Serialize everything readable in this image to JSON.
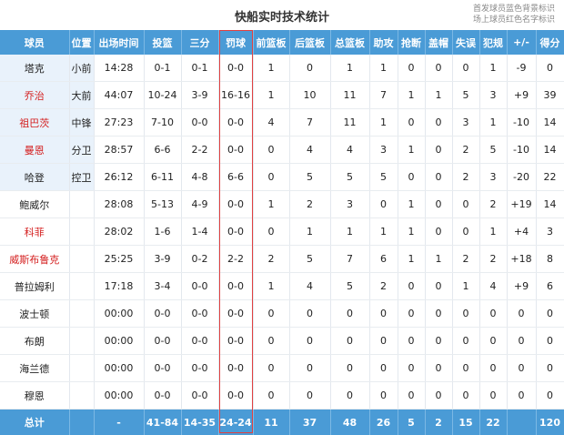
{
  "title": "快船实时技术统计",
  "legend": [
    "首发球员蓝色背景标识",
    "场上球员红色名字标识"
  ],
  "headers": [
    "球员",
    "位置",
    "出场时间",
    "投篮",
    "三分",
    "罚球",
    "前篮板",
    "后篮板",
    "总篮板",
    "助攻",
    "抢断",
    "盖帽",
    "失误",
    "犯规",
    "+/-",
    "得分"
  ],
  "rows": [
    {
      "name": "塔克",
      "starter": true,
      "on_court": false,
      "cells": [
        "小前",
        "14:28",
        "0-1",
        "0-1",
        "0-0",
        "1",
        "0",
        "1",
        "1",
        "0",
        "0",
        "0",
        "1",
        "-9",
        "0"
      ]
    },
    {
      "name": "乔治",
      "starter": true,
      "on_court": true,
      "cells": [
        "大前",
        "44:07",
        "10-24",
        "3-9",
        "16-16",
        "1",
        "10",
        "11",
        "7",
        "1",
        "1",
        "5",
        "3",
        "+9",
        "39"
      ]
    },
    {
      "name": "祖巴茨",
      "starter": true,
      "on_court": true,
      "cells": [
        "中锋",
        "27:23",
        "7-10",
        "0-0",
        "0-0",
        "4",
        "7",
        "11",
        "1",
        "0",
        "0",
        "3",
        "1",
        "-10",
        "14"
      ]
    },
    {
      "name": "曼恩",
      "starter": true,
      "on_court": true,
      "cells": [
        "分卫",
        "28:57",
        "6-6",
        "2-2",
        "0-0",
        "0",
        "4",
        "4",
        "3",
        "1",
        "0",
        "2",
        "5",
        "-10",
        "14"
      ]
    },
    {
      "name": "哈登",
      "starter": true,
      "on_court": false,
      "cells": [
        "控卫",
        "26:12",
        "6-11",
        "4-8",
        "6-6",
        "0",
        "5",
        "5",
        "5",
        "0",
        "0",
        "2",
        "3",
        "-20",
        "22"
      ]
    },
    {
      "name": "鲍威尔",
      "starter": false,
      "on_court": false,
      "cells": [
        "",
        "28:08",
        "5-13",
        "4-9",
        "0-0",
        "1",
        "2",
        "3",
        "0",
        "1",
        "0",
        "0",
        "2",
        "+19",
        "14"
      ]
    },
    {
      "name": "科菲",
      "starter": false,
      "on_court": true,
      "cells": [
        "",
        "28:02",
        "1-6",
        "1-4",
        "0-0",
        "0",
        "1",
        "1",
        "1",
        "1",
        "0",
        "0",
        "1",
        "+4",
        "3"
      ]
    },
    {
      "name": "威斯布鲁克",
      "starter": false,
      "on_court": true,
      "cells": [
        "",
        "25:25",
        "3-9",
        "0-2",
        "2-2",
        "2",
        "5",
        "7",
        "6",
        "1",
        "1",
        "2",
        "2",
        "+18",
        "8"
      ]
    },
    {
      "name": "普拉姆利",
      "starter": false,
      "on_court": false,
      "cells": [
        "",
        "17:18",
        "3-4",
        "0-0",
        "0-0",
        "1",
        "4",
        "5",
        "2",
        "0",
        "0",
        "1",
        "4",
        "+9",
        "6"
      ]
    },
    {
      "name": "波士顿",
      "starter": false,
      "on_court": false,
      "cells": [
        "",
        "00:00",
        "0-0",
        "0-0",
        "0-0",
        "0",
        "0",
        "0",
        "0",
        "0",
        "0",
        "0",
        "0",
        "0",
        "0"
      ]
    },
    {
      "name": "布朗",
      "starter": false,
      "on_court": false,
      "cells": [
        "",
        "00:00",
        "0-0",
        "0-0",
        "0-0",
        "0",
        "0",
        "0",
        "0",
        "0",
        "0",
        "0",
        "0",
        "0",
        "0"
      ]
    },
    {
      "name": "海兰德",
      "starter": false,
      "on_court": false,
      "cells": [
        "",
        "00:00",
        "0-0",
        "0-0",
        "0-0",
        "0",
        "0",
        "0",
        "0",
        "0",
        "0",
        "0",
        "0",
        "0",
        "0"
      ]
    },
    {
      "name": "穆恩",
      "starter": false,
      "on_court": false,
      "cells": [
        "",
        "00:00",
        "0-0",
        "0-0",
        "0-0",
        "0",
        "0",
        "0",
        "0",
        "0",
        "0",
        "0",
        "0",
        "0",
        "0"
      ]
    }
  ],
  "totals": [
    "总计",
    "",
    "-",
    "41-84",
    "14-35",
    "24-24",
    "11",
    "37",
    "48",
    "26",
    "5",
    "2",
    "15",
    "22",
    "",
    "120"
  ],
  "colors": {
    "header": "#4a9bd6",
    "starter_bg": "#e9f2fb",
    "on_court_name": "#d42020",
    "highlight_border": "#e04040"
  }
}
